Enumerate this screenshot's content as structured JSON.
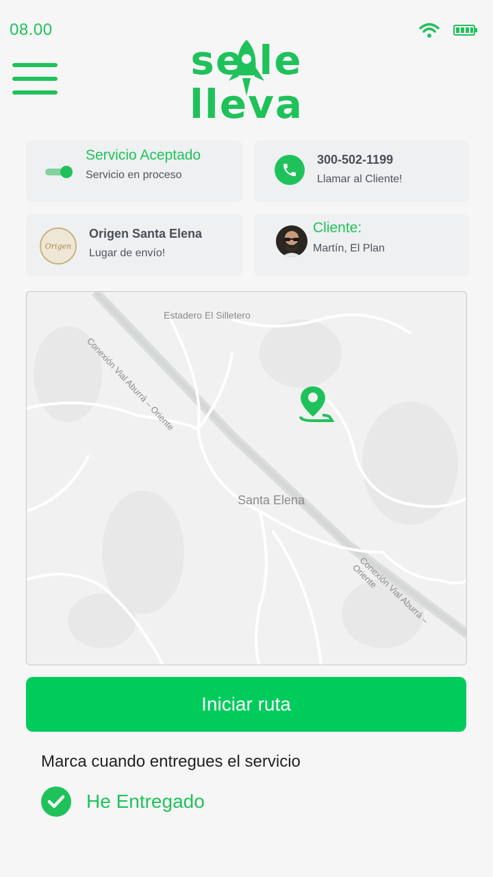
{
  "status_bar": {
    "time": "08.00",
    "wifi_icon": "wifi-icon",
    "battery_icon": "battery-icon"
  },
  "header": {
    "menu_icon": "hamburger-menu-icon",
    "logo_text": "se le lleva"
  },
  "service_card": {
    "title": "Servicio Aceptado",
    "subtitle": "Servicio en proceso",
    "toggle_on": true
  },
  "phone_card": {
    "number": "300-502-1199",
    "subtitle": "Llamar al Cliente!",
    "icon": "phone-icon"
  },
  "origin_card": {
    "logo_text": "Origen",
    "title": "Origen Santa Elena",
    "subtitle": "Lugar de envío!"
  },
  "client_card": {
    "title": "Cliente:",
    "subtitle": "Martín, El Plan"
  },
  "map": {
    "labels": {
      "place_top": "Estadero El Silletero",
      "road_top": "Conexión Vial Aburrá – Oriente",
      "town": "Santa Elena",
      "road_bottom": "Conexión Vial Aburrá – Oriente"
    },
    "pin_icon": "location-pin-icon"
  },
  "actions": {
    "start_route": "Iniciar ruta",
    "hint": "Marca cuando entregues el servicio",
    "delivered": "He Entregado"
  },
  "colors": {
    "accent": "#1fc25a",
    "button": "#00cc5c",
    "card": "#eef0f2",
    "background": "#f6f6f6"
  }
}
